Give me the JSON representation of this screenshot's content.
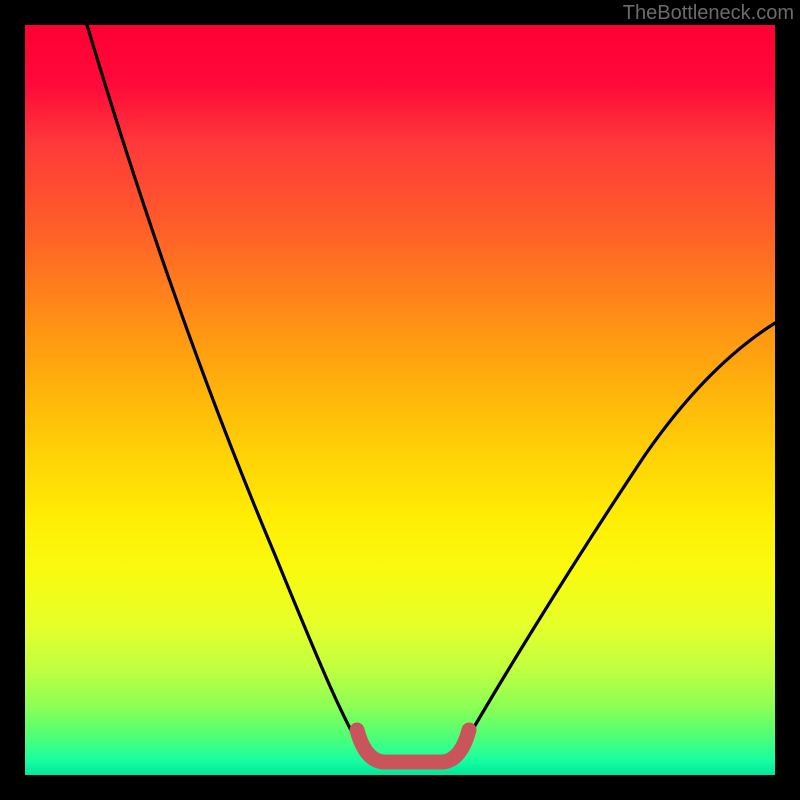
{
  "watermark": "TheBottleneck.com",
  "chart_data": {
    "type": "line",
    "title": "",
    "xlabel": "",
    "ylabel": "",
    "xlim": [
      0,
      100
    ],
    "ylim": [
      0,
      100
    ],
    "series": [
      {
        "name": "left-curve",
        "x": [
          10,
          15,
          20,
          25,
          30,
          35,
          40,
          44,
          47
        ],
        "values": [
          100,
          80,
          62,
          46,
          33,
          22,
          13,
          6,
          2
        ]
      },
      {
        "name": "right-curve",
        "x": [
          57,
          60,
          65,
          70,
          75,
          80,
          85,
          90,
          95,
          100
        ],
        "values": [
          2,
          5,
          11,
          18,
          26,
          34,
          42,
          49,
          55,
          60
        ]
      },
      {
        "name": "bottom-bracket",
        "x": [
          45,
          46,
          47,
          57,
          58,
          59
        ],
        "values": [
          6,
          3,
          2,
          2,
          3,
          6
        ]
      }
    ],
    "background_gradient": {
      "top": "#ff0033",
      "mid1": "#ff9a12",
      "mid2": "#ffee05",
      "bottom": "#00e69b"
    },
    "bracket_color": "#c9545b",
    "curve_color": "#000000"
  }
}
